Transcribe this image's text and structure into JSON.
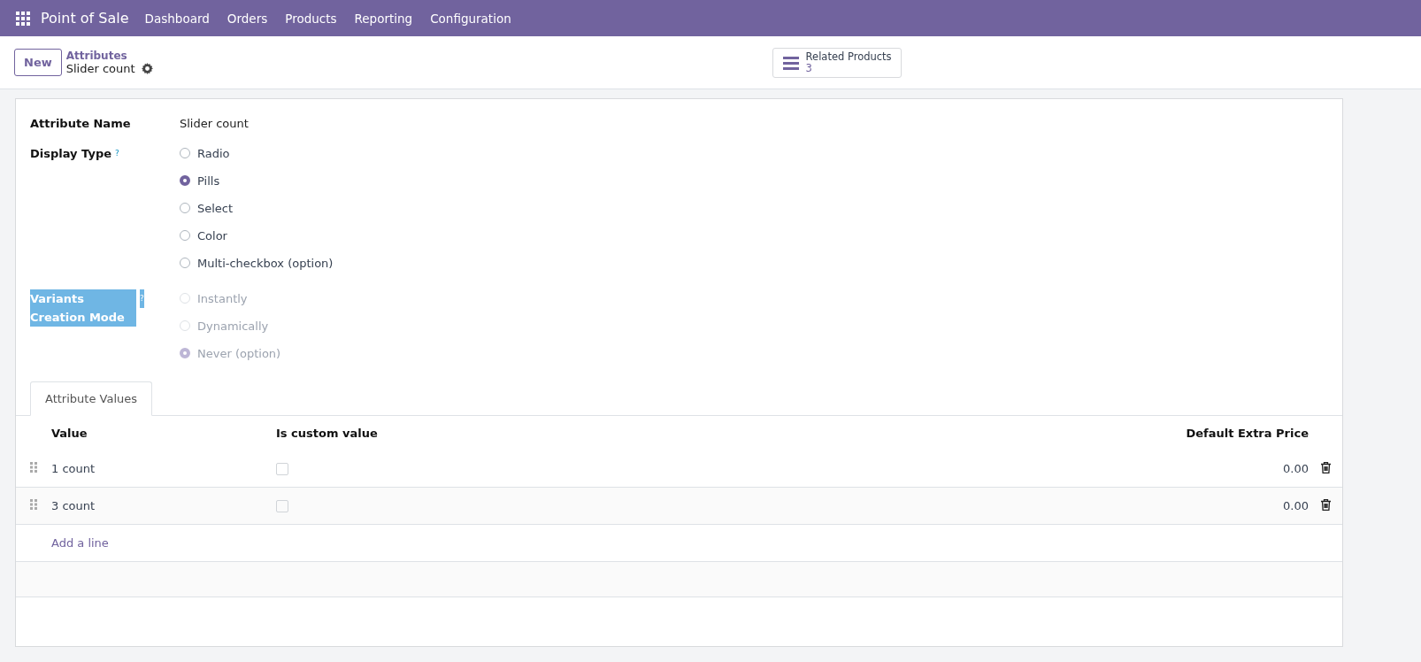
{
  "navbar": {
    "app_name": "Point of Sale",
    "menu": [
      "Dashboard",
      "Orders",
      "Products",
      "Reporting",
      "Configuration"
    ]
  },
  "control_panel": {
    "new_button": "New",
    "breadcrumb": "Attributes",
    "record_title": "Slider count",
    "smart_button": {
      "label": "Related Products",
      "count": "3"
    }
  },
  "form": {
    "attribute_name": {
      "label": "Attribute Name",
      "value": "Slider count"
    },
    "fields": [
      {
        "label": "Display Type",
        "help": "?",
        "highlighted": false,
        "disabled": false,
        "options": [
          {
            "label": "Radio",
            "selected": false
          },
          {
            "label": "Pills",
            "selected": true
          },
          {
            "label": "Select",
            "selected": false
          },
          {
            "label": "Color",
            "selected": false
          },
          {
            "label": "Multi-checkbox (option)",
            "selected": false
          }
        ]
      },
      {
        "label": "Variants Creation Mode",
        "help": "?",
        "highlighted": true,
        "disabled": true,
        "options": [
          {
            "label": "Instantly",
            "selected": false
          },
          {
            "label": "Dynamically",
            "selected": false
          },
          {
            "label": "Never (option)",
            "selected": true
          }
        ]
      }
    ]
  },
  "notebook": {
    "tabs": [
      {
        "label": "Attribute Values",
        "selected": true
      }
    ],
    "table": {
      "columns": [
        "Value",
        "Is custom value",
        "Default Extra Price"
      ],
      "rows": [
        {
          "value": "1 count",
          "is_custom": false,
          "price": "0.00"
        },
        {
          "value": "3 count",
          "is_custom": false,
          "price": "0.00"
        }
      ],
      "add_line": "Add a line"
    }
  }
}
